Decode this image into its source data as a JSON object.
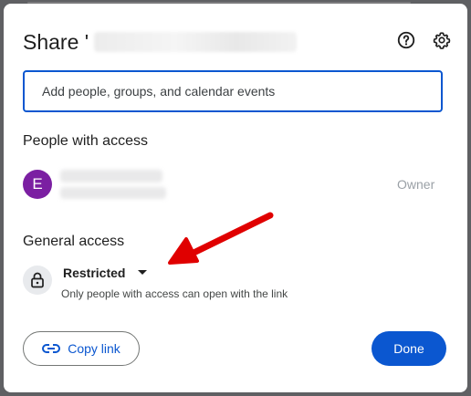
{
  "dialog": {
    "title_prefix": "Share '",
    "help_icon": "help-circle-icon",
    "settings_icon": "gear-icon"
  },
  "add_people": {
    "placeholder": "Add people, groups, and calendar events"
  },
  "people_with_access": {
    "heading": "People with access",
    "people": [
      {
        "avatar_initial": "E",
        "avatar_color": "#7b1fa2",
        "role": "Owner"
      }
    ]
  },
  "general_access": {
    "heading": "General access",
    "icon": "lock-icon",
    "level": "Restricted",
    "description": "Only people with access can open with the link"
  },
  "annotation": {
    "arrow_color": "#e00000"
  },
  "footer": {
    "copy_link_label": "Copy link",
    "copy_link_icon": "link-icon",
    "done_label": "Done"
  },
  "colors": {
    "accent": "#0b57d0",
    "owner_text": "#9aa0a6"
  }
}
